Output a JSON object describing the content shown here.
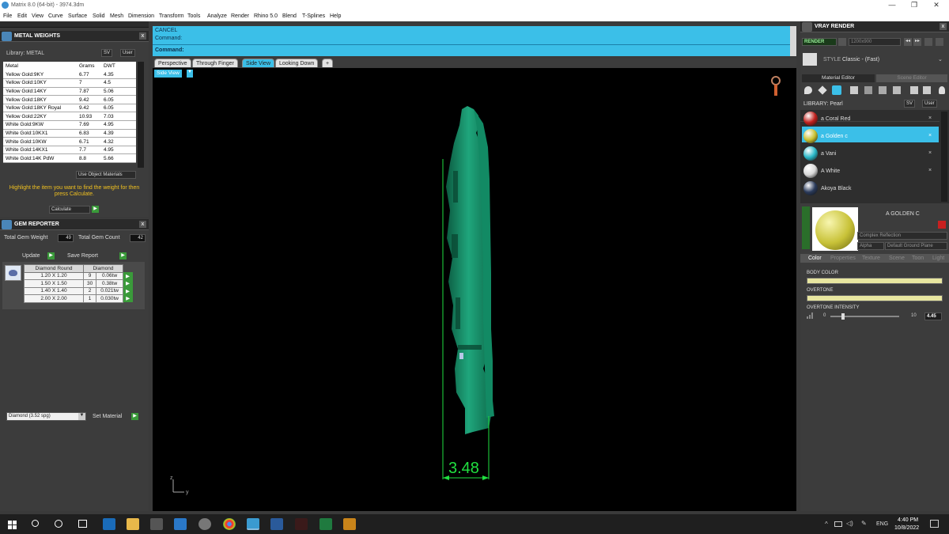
{
  "window": {
    "title": "Matrix 8.0 (64-bit) - 3974.3dm",
    "min": "—",
    "max": "❐",
    "close": "✕"
  },
  "menu": [
    "File",
    "Edit",
    "View",
    "Curve",
    "Surface",
    "Solid",
    "Mesh",
    "Dimension",
    "Transform",
    "Tools",
    "Analyze",
    "Render",
    "Rhino 5.0",
    "Blend",
    "T-Splines",
    "Help"
  ],
  "metal_weights": {
    "title": "METAL WEIGHTS",
    "library_label": "Library: METAL",
    "sv_label": "SV",
    "user_label": "User",
    "columns": [
      "Metal",
      "Grams",
      "DWT"
    ],
    "rows": [
      [
        "Yellow Gold:9KY",
        "6.77",
        "4.35"
      ],
      [
        "Yellow Gold:10KY",
        "7",
        "4.5"
      ],
      [
        "Yellow Gold:14KY",
        "7.87",
        "5.06"
      ],
      [
        "Yellow Gold:18KY",
        "9.42",
        "6.05"
      ],
      [
        "Yellow Gold:18KY Royal",
        "9.42",
        "6.05"
      ],
      [
        "Yellow Gold:22KY",
        "10.93",
        "7.03"
      ],
      [
        "White Gold:9KW",
        "7.69",
        "4.95"
      ],
      [
        "White Gold:10KX1",
        "6.83",
        "4.39"
      ],
      [
        "White Gold:10KW",
        "6.71",
        "4.32"
      ],
      [
        "White Gold:14KX1",
        "7.7",
        "4.95"
      ],
      [
        "White Gold:14K PdW",
        "8.8",
        "5.66"
      ]
    ],
    "use_object_materials": "Use Object Materials",
    "instruction": "Highlight the item you want to find the weight for then press Calculate.",
    "calculate": "Calculate"
  },
  "gem_reporter": {
    "title": "GEM REPORTER",
    "total_weight_label": "Total Gem Weight",
    "total_weight": "49",
    "total_count_label": "Total Gem Count",
    "total_count": "42",
    "update": "Update",
    "save_report": "Save Report",
    "col_shape": "Diamond Round",
    "col_material": "Diamond",
    "rows": [
      [
        "1.20 X 1.20",
        "9",
        "0.06tw"
      ],
      [
        "1.50 X 1.50",
        "30",
        "0.38tw"
      ],
      [
        "1.40 X 1.40",
        "2",
        "0.021tw"
      ],
      [
        "2.00 X 2.00",
        "1",
        "0.030tw"
      ]
    ],
    "material_select": "Diamond    (3.52 spg)",
    "set_material": "Set Material"
  },
  "command": {
    "line1": "CANCEL",
    "line2": "Command:",
    "prompt": "Command:"
  },
  "tabs": [
    "Perspective",
    "Through Finger",
    "Side View",
    "Looking Down",
    "+"
  ],
  "viewport": {
    "label": "Side View",
    "dimension": "3.48",
    "axis_z": "z",
    "axis_y": "y"
  },
  "vray": {
    "title": "VRAY RENDER",
    "render": "RENDER",
    "resolution": "1200x900",
    "style_label": "STYLE",
    "style_value": "Classic - (Fast)",
    "tab_material": "Material Editor",
    "tab_scene": "Scene Editor",
    "library_label": "LIBRARY: Pearl",
    "sv_label": "SV",
    "user_label": "User",
    "materials": [
      {
        "name": "a Coral Red",
        "color": "#c0201c"
      },
      {
        "name": "a Golden c",
        "color": "#c8c030"
      },
      {
        "name": "a Vani",
        "color": "#2ab8c8"
      },
      {
        "name": "A White",
        "color": "#d8d8d8"
      },
      {
        "name": "Akoya Black",
        "color": "#2a3a5a"
      }
    ],
    "selected_name": "A GOLDEN C",
    "reflection": "Complex Reflection",
    "alpha": "Alpha",
    "ground": "Default Ground Plane",
    "prop_tabs": [
      "Color",
      "Properties",
      "Texture",
      "Scene",
      "Toon",
      "Light"
    ],
    "body_color": "BODY COLOR",
    "overtone": "OVERTONE",
    "overtone_intensity": "OVERTONE INTENSITY",
    "intensity_min": "0",
    "intensity_max": "10",
    "intensity_value": "4.45",
    "accent_color": "#3bbfe8"
  },
  "taskbar": {
    "lang": "ENG",
    "time": "4:40 PM",
    "date": "10/8/2022"
  }
}
